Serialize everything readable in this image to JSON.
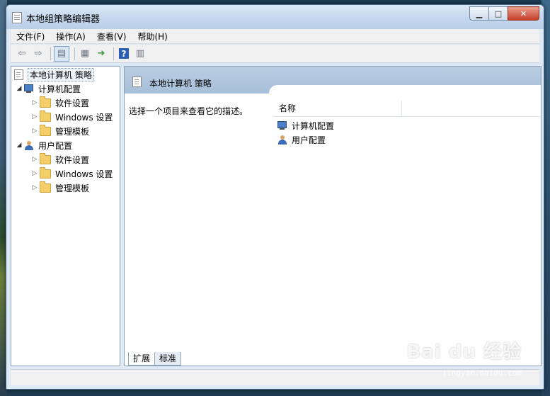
{
  "window": {
    "title": "本地组策略编辑器",
    "minimize": "0",
    "maximize": "1",
    "close": "r"
  },
  "menu": [
    "文件(F)",
    "操作(A)",
    "查看(V)",
    "帮助(H)"
  ],
  "toolbar": [
    "back",
    "forward",
    "show-hide-tree",
    "properties",
    "export",
    "help",
    "view"
  ],
  "tree": {
    "root": "本地计算机 策略",
    "computer": "计算机配置",
    "computer_children": [
      "软件设置",
      "Windows 设置",
      "管理模板"
    ],
    "user": "用户配置",
    "user_children": [
      "软件设置",
      "Windows 设置",
      "管理模板"
    ]
  },
  "main": {
    "header_title": "本地计算机 策略",
    "description": "选择一个项目来查看它的描述。",
    "column_name": "名称",
    "items": [
      "计算机配置",
      "用户配置"
    ]
  },
  "tabs": [
    "扩展",
    "标准"
  ],
  "watermark": {
    "brand": "Bai du 经验",
    "url": "jingyan.baidu.com"
  }
}
